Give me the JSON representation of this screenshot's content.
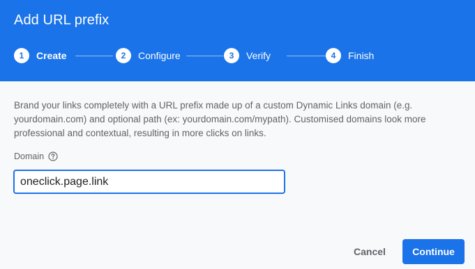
{
  "dialog": {
    "title": "Add URL prefix"
  },
  "steps": [
    {
      "number": "1",
      "label": "Create",
      "state": "active"
    },
    {
      "number": "2",
      "label": "Configure",
      "state": "upcoming"
    },
    {
      "number": "3",
      "label": "Verify",
      "state": "upcoming"
    },
    {
      "number": "4",
      "label": "Finish",
      "state": "upcoming"
    }
  ],
  "content": {
    "description": "Brand your links completely with a URL prefix made up of a custom Dynamic Links domain (e.g. yourdomain.com) and optional path (ex: yourdomain.com/mypath). Customised domains look more professional and contextual, resulting in more clicks on links.",
    "domain_label": "Domain",
    "domain_help_icon": "help-circle-icon",
    "domain_value": "oneclick.page.link"
  },
  "actions": {
    "cancel_label": "Cancel",
    "continue_label": "Continue"
  },
  "colors": {
    "primary": "#1a73e8",
    "background": "#f8f9fa",
    "text_secondary": "#5f6368"
  }
}
